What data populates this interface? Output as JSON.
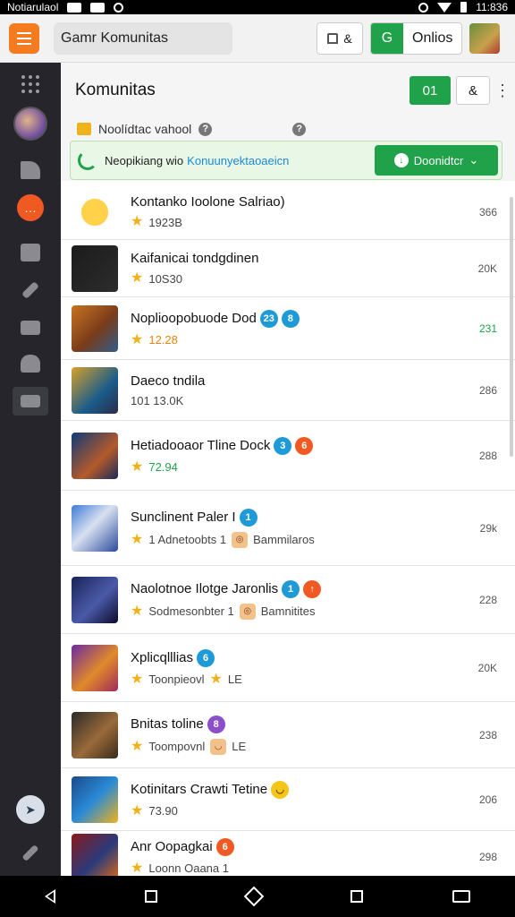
{
  "status_bar": {
    "left_text": "Notiarulaol",
    "time": "11:836"
  },
  "top_bar": {
    "search_text": "Gamr Komunitas",
    "square_label": "&",
    "green_label": "G",
    "online_label": "Onlios"
  },
  "header": {
    "title": "Komunitas",
    "green_button": "01",
    "user_button": "&",
    "more": "⋮"
  },
  "subheader": {
    "text": "Noolídtac vahool",
    "help": "?"
  },
  "notice": {
    "text": "Neopikiang wio",
    "link": "Konuunyektaoaeicn",
    "button_label": "Doonidtcr"
  },
  "sidebar": {
    "chat_glyph": "…",
    "compass_glyph": "➤"
  },
  "rows": [
    {
      "name": "Kontanko Ioolone Salriao)",
      "meta": "1923B",
      "rating_color": "",
      "count": "366",
      "badges": [],
      "tags": [],
      "thumb": "sun"
    },
    {
      "name": "Kaifanicai tondgdinen",
      "meta": "10S30",
      "rating_color": "",
      "count": "20K",
      "badges": [],
      "tags": [],
      "thumb": "dark"
    },
    {
      "name": "Noplioopobuode",
      "name2": "Dod",
      "meta": "12.28",
      "rating_color": "orange",
      "count": "231",
      "count_color": "green",
      "badges": [
        {
          "t": "23",
          "c": "blue"
        },
        {
          "t": "8",
          "c": "blue"
        }
      ],
      "tags": [],
      "thumb": "game1"
    },
    {
      "name": "Daeco tndila",
      "meta": "101 13.0K",
      "no_star": true,
      "rating_color": "",
      "count": "286",
      "badges": [],
      "tags": [],
      "thumb": "game2"
    },
    {
      "name": "Hetiadooaor Tline",
      "name2": "Dock",
      "meta": "72.94",
      "rating_color": "green",
      "count": "288",
      "badges": [
        {
          "t": "3",
          "c": "blue"
        },
        {
          "t": "6",
          "c": "orange"
        }
      ],
      "tags": [],
      "thumb": "game3"
    },
    {
      "name": "Sunclinent Paler I",
      "meta": "1 Adnetoobts 1",
      "rating_color": "",
      "count": "29k",
      "badges": [
        {
          "t": "1",
          "c": "blue"
        }
      ],
      "tag_text": "Bammilaros",
      "thumb": "game4"
    },
    {
      "name": "Naolotnoe Ilotge Jaronlis",
      "meta": "Sodmesonbter 1",
      "rating_color": "",
      "count": "228",
      "badges": [
        {
          "t": "1",
          "c": "blue"
        },
        {
          "t": "↑",
          "c": "orange"
        }
      ],
      "tag_text": "Bamnitites",
      "thumb": "game5"
    },
    {
      "name": "Xplicqlllias",
      "meta": "Toonpieovl",
      "rating_color": "",
      "count": "20K",
      "badges": [
        {
          "t": "6",
          "c": "blue"
        }
      ],
      "tag_text": "LE",
      "star_tag": true,
      "thumb": "game6"
    },
    {
      "name": "Bnitas toline",
      "meta": "Toompovnl",
      "rating_color": "",
      "count": "238",
      "badges": [
        {
          "t": "8",
          "c": "purple"
        }
      ],
      "tag_text": "LE",
      "smile_tag": true,
      "thumb": "game7"
    },
    {
      "name": "Kotinitars Crawti Tetine",
      "meta": "73.90",
      "rating_color": "",
      "count": "206",
      "badges": [
        {
          "t": "◡",
          "c": "yellow"
        }
      ],
      "tags": [],
      "thumb": "game8"
    },
    {
      "name": "Anr Oopagkai",
      "meta": "Loonn Oaana 1",
      "rating_color": "",
      "count": "298",
      "badges": [
        {
          "t": "6",
          "c": "orange"
        }
      ],
      "tags": [],
      "thumb": "game9"
    }
  ]
}
